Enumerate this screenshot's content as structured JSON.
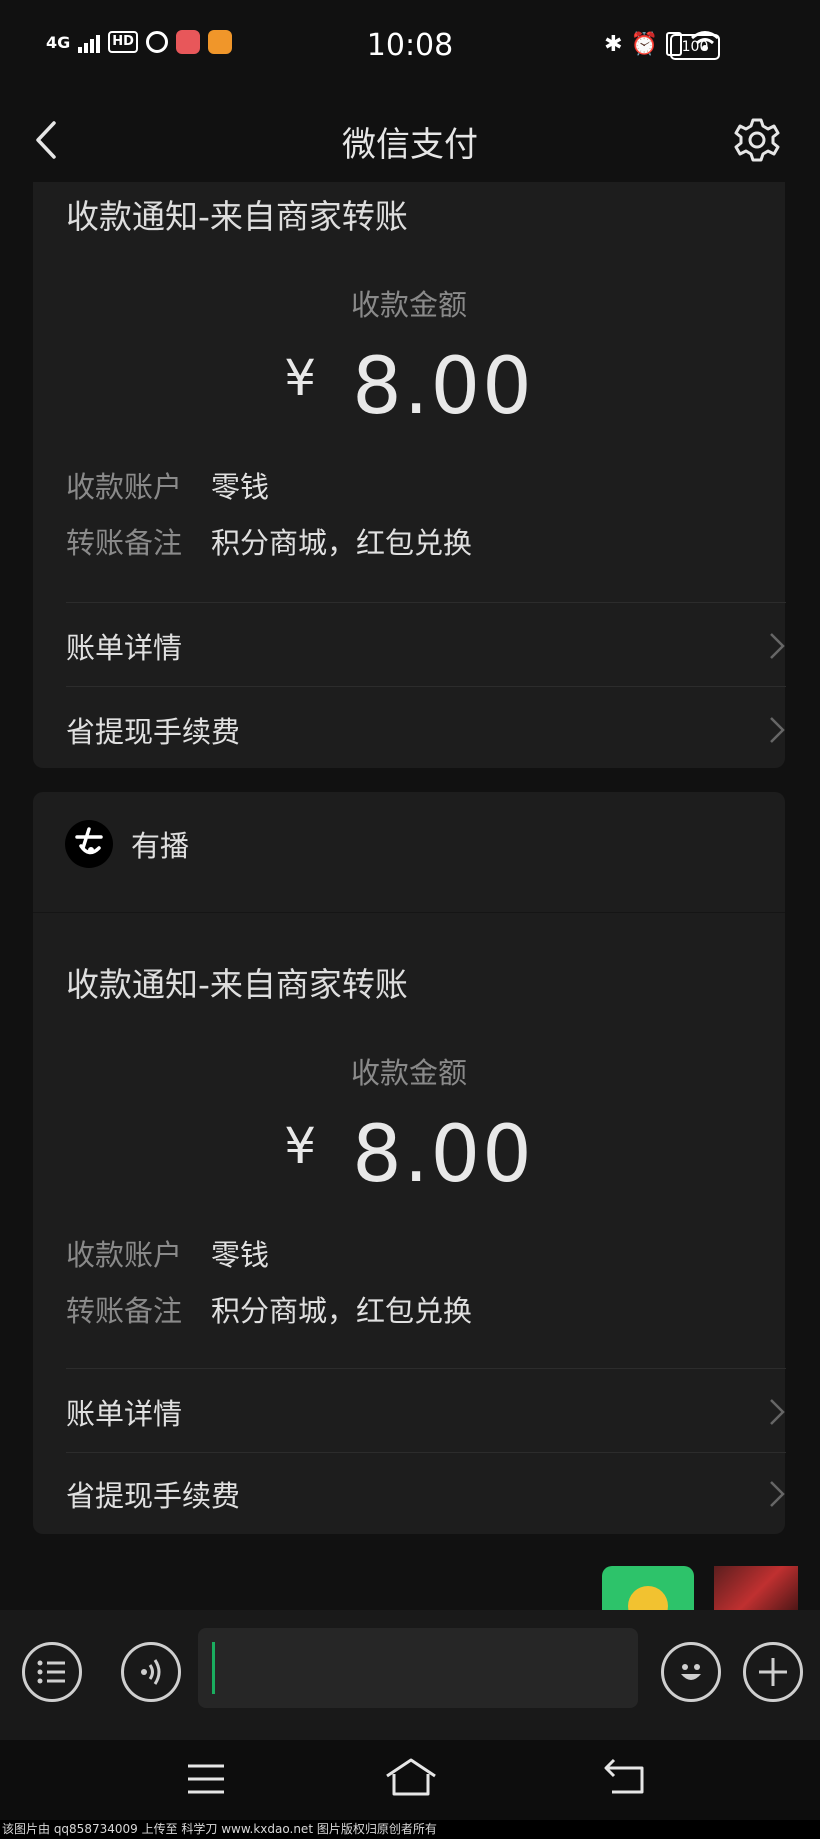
{
  "status_bar": {
    "network": "4G",
    "hd": "HD",
    "time": "10:08",
    "battery": "100"
  },
  "nav": {
    "title": "微信支付",
    "back_icon": "chevron-left-icon",
    "settings_icon": "gear-icon"
  },
  "cards": [
    {
      "merchant": "",
      "notice_title": "收款通知-来自商家转账",
      "amount_label": "收款金额",
      "currency": "¥",
      "amount": "8.00",
      "account_key": "收款账户",
      "account_value": "零钱",
      "remark_key": "转账备注",
      "remark_value": "积分商城，红包兑换",
      "bill_detail": "账单详情",
      "fee_saving": "省提现手续费"
    },
    {
      "merchant": "有播",
      "notice_title": "收款通知-来自商家转账",
      "amount_label": "收款金额",
      "currency": "¥",
      "amount": "8.00",
      "account_key": "收款账户",
      "account_value": "零钱",
      "remark_key": "转账备注",
      "remark_value": "积分商城，红包兑换",
      "bill_detail": "账单详情",
      "fee_saving": "省提现手续费"
    }
  ],
  "colors": {
    "accent": "#1aad5f",
    "background": "#111111",
    "card": "#1d1d1d"
  },
  "footer": {
    "text": "该图片由 qq858734009 上传至 科学刀 www.kxdao.net 图片版权归原创者所有"
  }
}
